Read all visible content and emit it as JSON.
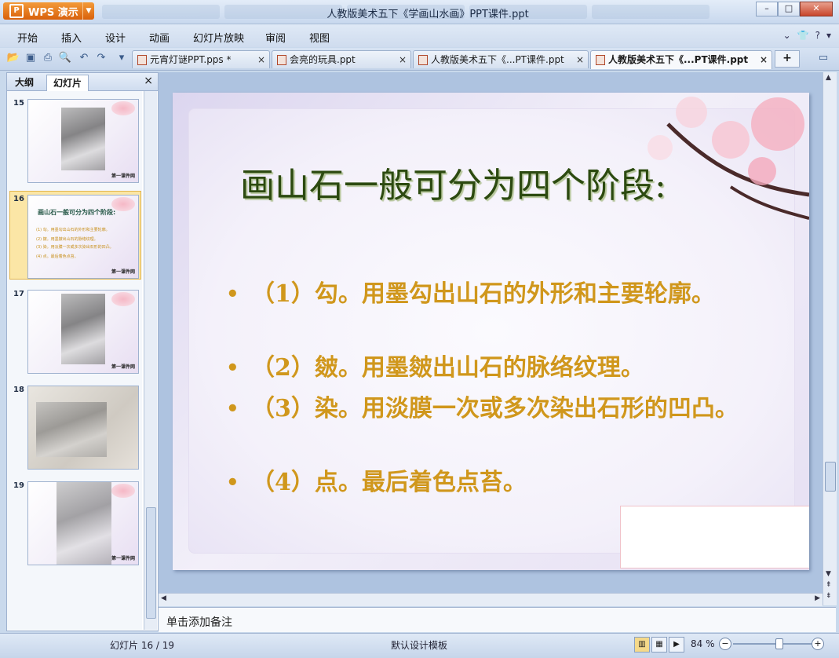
{
  "app": {
    "name": "WPS 演示",
    "window_title": "人教版美术五下《学画山水画》PPT课件.ppt"
  },
  "menu": [
    "开始",
    "插入",
    "设计",
    "动画",
    "幻灯片放映",
    "审阅",
    "视图"
  ],
  "doc_tabs": [
    {
      "label": "元宵灯谜PPT.pps *",
      "active": false
    },
    {
      "label": "会亮的玩具.ppt",
      "active": false
    },
    {
      "label": "人教版美术五下《...PT课件.ppt",
      "active": false
    },
    {
      "label": "人教版美术五下《...PT课件.ppt",
      "active": true
    }
  ],
  "left_pane": {
    "tabs": [
      "大纲",
      "幻灯片"
    ],
    "active_tab": "幻灯片",
    "slides": [
      {
        "num": "15",
        "brand": "第一课件网"
      },
      {
        "num": "16",
        "brand": "第一课件网",
        "selected": true,
        "title": "画山石一般可分为四个阶段:",
        "bullets": [
          "(1) 勾。用墨勾出山石的外形和主要轮廓。",
          "(2) 皴。用墨皴出山石的脉络纹理。",
          "(3) 染。用淡膜一次或多次染出石形的凹凸。",
          "(4) 点。最后着色点苔。"
        ]
      },
      {
        "num": "17",
        "brand": "第一课件网"
      },
      {
        "num": "18",
        "brand": ""
      },
      {
        "num": "19",
        "brand": "第一课件网"
      }
    ]
  },
  "slide": {
    "title": "画山石一般可分为四个阶段:",
    "bullets": [
      "（1）勾。用墨勾出山石的外形和主要轮廓。",
      "（2）皴。用墨皴出山石的脉络纹理。",
      "（3）染。用淡膜一次或多次染出石形的凹凸。",
      "（4）点。最后着色点苔。"
    ]
  },
  "notes_placeholder": "单击添加备注",
  "status": {
    "slide_indicator": "幻灯片 16 / 19",
    "template": "默认设计模板",
    "zoom": "84 %",
    "zoom_value": 84
  },
  "icons": {
    "close": "×",
    "add": "+"
  }
}
